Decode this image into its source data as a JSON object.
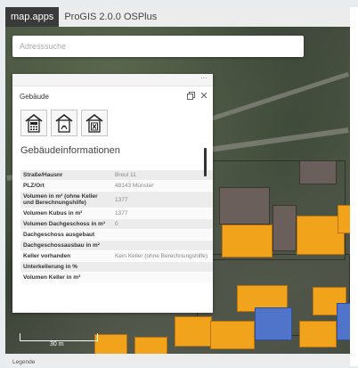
{
  "header": {
    "brand": "map.apps",
    "title": "ProGIS 2.0.0 OSPlus"
  },
  "search": {
    "placeholder": "Adresssuche"
  },
  "panel": {
    "dots": "···",
    "title": "Gebäude",
    "tools": [
      {
        "icon": "building-calculator-icon"
      },
      {
        "icon": "building-pdf-icon"
      },
      {
        "icon": "building-excel-icon"
      }
    ],
    "section_title": "Gebäudeinformationen",
    "rows": [
      {
        "key": "Straße/Hausnr",
        "value": "Breul 11"
      },
      {
        "key": "PLZ/Ort",
        "value": "48143 Münster"
      },
      {
        "key": "Volumen in m³ (ohne Keller und Berechnungshilfe)",
        "value": "1377"
      },
      {
        "key": "Volumen Kubus in m³",
        "value": "1377"
      },
      {
        "key": "Volumen Dachgeschoss in m³",
        "value": "0"
      },
      {
        "key": "Dachgeschoss ausgebaut",
        "value": ""
      },
      {
        "key": "Dachgeschossausbau in m²",
        "value": ""
      },
      {
        "key": "Keller vorhanden",
        "value": "Kein Keller (ohne Berechnungshilfe)"
      },
      {
        "key": "Unterkellerung in %",
        "value": ""
      },
      {
        "key": "Volumen Keller in m³",
        "value": ""
      }
    ]
  },
  "map": {
    "scale_label": "30 m",
    "building_color": "#f2a31c"
  },
  "footer": {
    "legend_label": "Legende"
  }
}
